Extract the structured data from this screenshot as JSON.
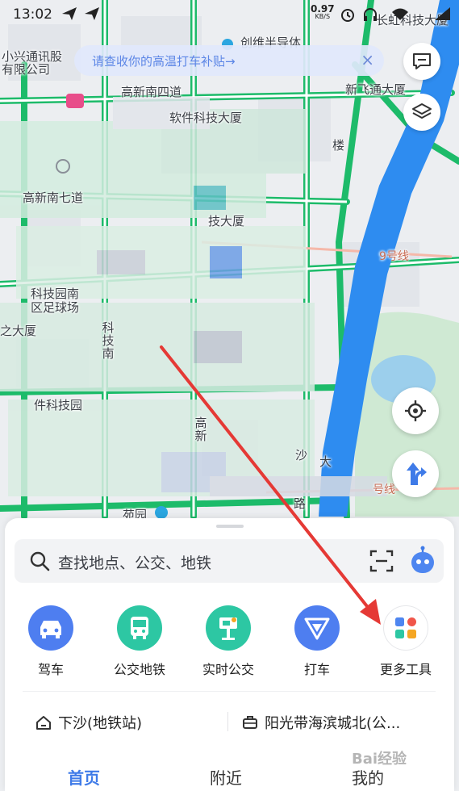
{
  "status_bar": {
    "time": "13:02",
    "net_speed_value": "0.97",
    "net_speed_unit": "KB/S"
  },
  "notice": {
    "text": "请查收你的高温打车补贴→",
    "close_glyph": "×"
  },
  "map_labels": [
    "小兴通讯股",
    "有限公司",
    "创维半导体",
    "高新南四道",
    "软件科技大厦",
    "新飞通大厦",
    "楼",
    "高新南七道",
    "技大厦",
    "科技园南",
    "区足球场",
    "之大厦",
    "科技南",
    "件科技园",
    "高新",
    "沙",
    "大",
    "路",
    "9号线",
    "号线",
    "苑园",
    "长虹科技大厦"
  ],
  "search": {
    "placeholder": "查找地点、公交、地铁"
  },
  "quick_actions": [
    {
      "label": "驾车",
      "icon": "car-icon",
      "color": "#4e7ef0"
    },
    {
      "label": "公交地铁",
      "icon": "bus-icon",
      "color": "#2dc7a3"
    },
    {
      "label": "实时公交",
      "icon": "bus-stop-icon",
      "color": "#2dc7a3"
    },
    {
      "label": "打车",
      "icon": "taxi-icon",
      "color": "#4e7ef0"
    },
    {
      "label": "更多工具",
      "icon": "more-tools-icon",
      "color": "#ffffff"
    }
  ],
  "recent": [
    {
      "label": "下沙(地铁站)",
      "icon": "home-icon"
    },
    {
      "label": "阳光带海滨城北(公...",
      "icon": "briefcase-icon"
    }
  ],
  "tabs": [
    {
      "label": "首页",
      "active": true
    },
    {
      "label": "附近",
      "active": false
    },
    {
      "label": "我的",
      "active": false
    }
  ],
  "watermark": "Bai经验",
  "colors": {
    "road_green": "#1dbb6a",
    "river_blue": "#2e8cf0",
    "accent_blue": "#3f7be8",
    "arrow_red": "#e53935"
  }
}
